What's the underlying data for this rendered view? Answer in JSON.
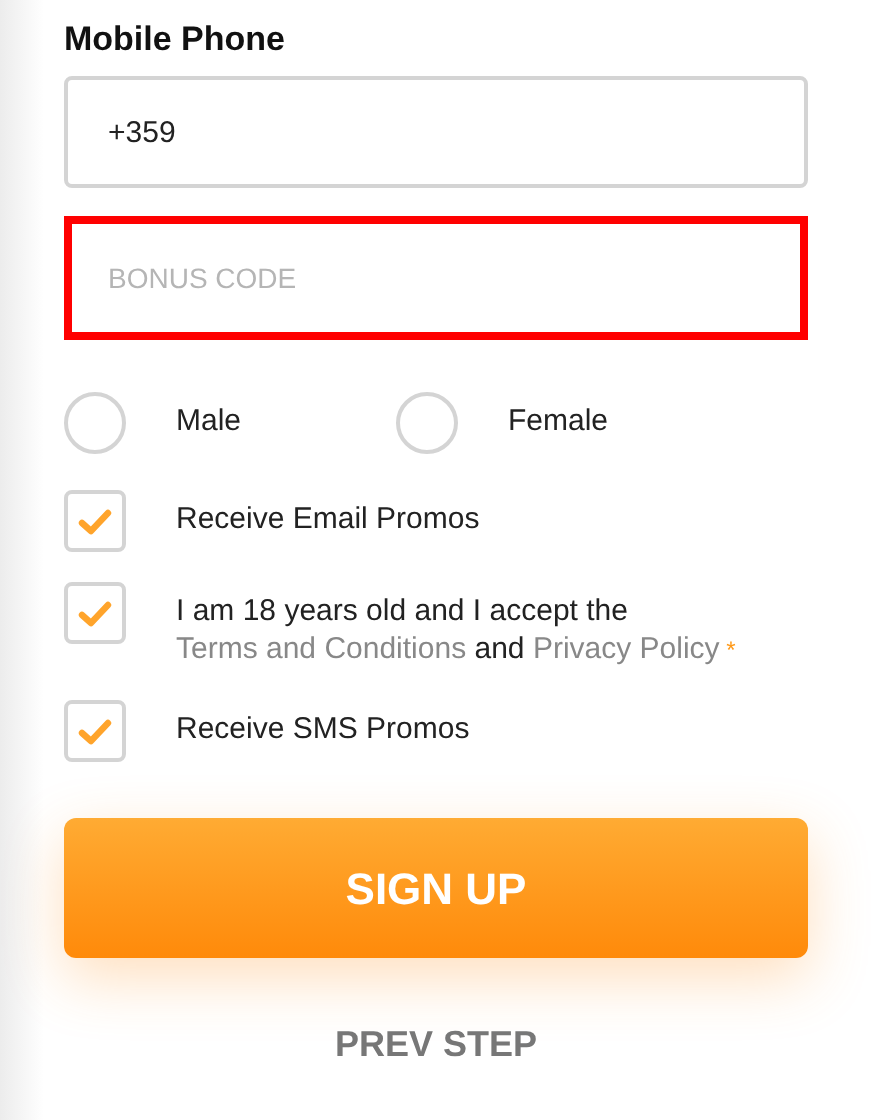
{
  "phone": {
    "label": "Mobile Phone",
    "value": "+359"
  },
  "bonus_code": {
    "placeholder": "BONUS CODE",
    "highlighted": true
  },
  "gender": [
    {
      "label": "Male",
      "selected": false
    },
    {
      "label": "Female",
      "selected": false
    }
  ],
  "agreements": [
    {
      "parts": [
        {
          "kind": "text",
          "text": "Receive Email Promos"
        }
      ],
      "checked": true
    },
    {
      "parts": [
        {
          "kind": "text",
          "text": "I am 18 years old and I accept the "
        },
        {
          "kind": "link",
          "text": "Terms and Conditions"
        },
        {
          "kind": "text",
          "text": " and "
        },
        {
          "kind": "link",
          "text": "Privacy Policy"
        },
        {
          "kind": "required",
          "text": " *"
        }
      ],
      "checked": true
    },
    {
      "parts": [
        {
          "kind": "text",
          "text": "Receive SMS Promos"
        }
      ],
      "checked": true
    }
  ],
  "buttons": {
    "primary": "SIGN UP",
    "secondary": "PREV STEP"
  }
}
